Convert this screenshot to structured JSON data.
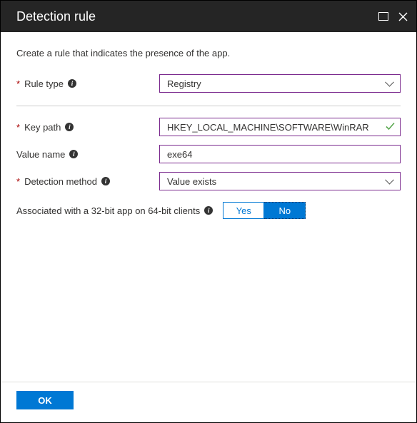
{
  "header": {
    "title": "Detection rule"
  },
  "intro": "Create a rule that indicates the presence of the app.",
  "fields": {
    "ruleType": {
      "label": "Rule type",
      "value": "Registry"
    },
    "keyPath": {
      "label": "Key path",
      "value": "HKEY_LOCAL_MACHINE\\SOFTWARE\\WinRAR"
    },
    "valueName": {
      "label": "Value name",
      "value": "exe64"
    },
    "detectionMethod": {
      "label": "Detection method",
      "value": "Value exists"
    }
  },
  "toggle": {
    "label": "Associated with a 32-bit app on 64-bit clients",
    "yes": "Yes",
    "no": "No"
  },
  "footer": {
    "ok": "OK"
  }
}
